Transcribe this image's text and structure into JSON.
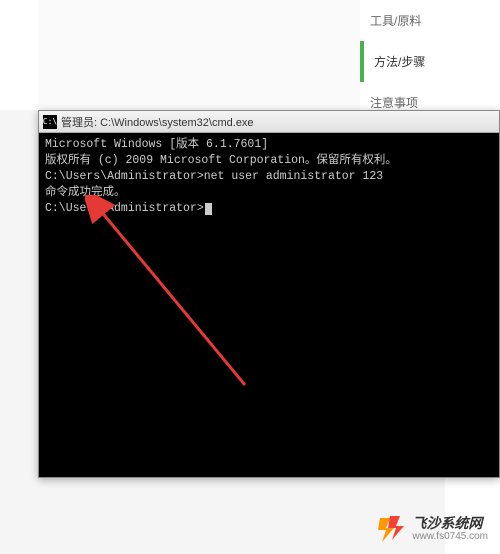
{
  "tabs": [
    {
      "label": "工具/原料",
      "active": false
    },
    {
      "label": "方法/步骤",
      "active": true
    },
    {
      "label": "注意事项",
      "active": false
    }
  ],
  "cmd": {
    "title": "管理员: C:\\Windows\\system32\\cmd.exe",
    "lines": [
      "Microsoft Windows [版本 6.1.7601]",
      "版权所有 (c) 2009 Microsoft Corporation。保留所有权利。",
      "",
      "C:\\Users\\Administrator>net user administrator 123",
      "命令成功完成。",
      "",
      "",
      "C:\\Users\\Administrator>"
    ],
    "icon_text": "C:\\"
  },
  "watermark": {
    "cn": "飞沙系统网",
    "url": "www.fs0745.com"
  }
}
